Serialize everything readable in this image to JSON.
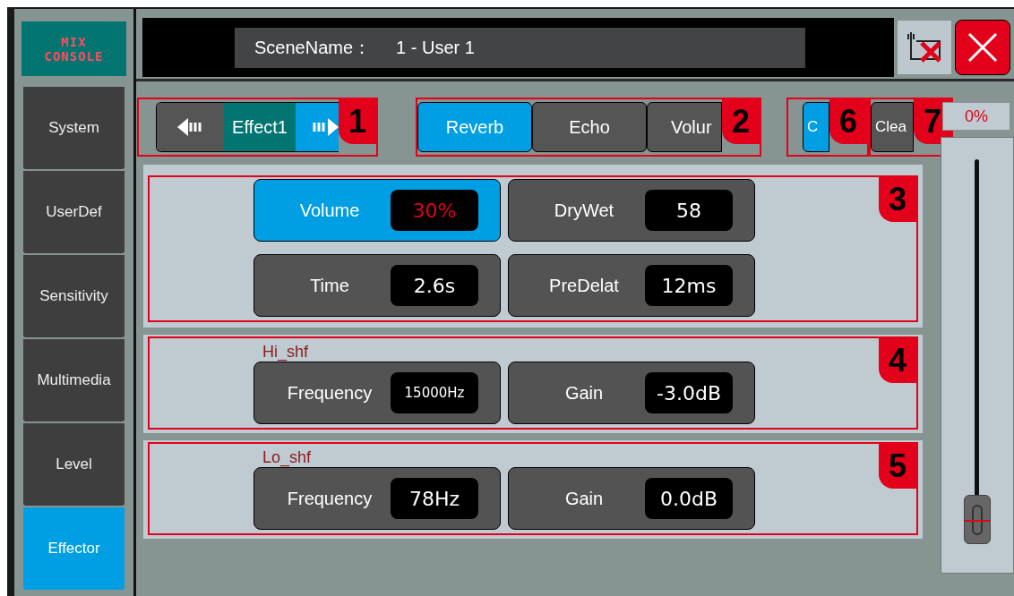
{
  "sidebar": {
    "logo_lines": [
      "MIX",
      "CONSOLE"
    ],
    "items": [
      {
        "label": "System",
        "selected": false
      },
      {
        "label": "UserDef",
        "selected": false
      },
      {
        "label": "Sensitivity",
        "selected": false
      },
      {
        "label": "Multimedia",
        "selected": false
      },
      {
        "label": "Level",
        "selected": false
      },
      {
        "label": "Effector",
        "selected": true
      }
    ]
  },
  "header": {
    "scene_label": "SceneName：",
    "scene_value": "1 - User 1"
  },
  "toolbar": {
    "effect_nav": {
      "label": "Effect1",
      "callout": "1"
    },
    "tabs": [
      {
        "label": "Reverb",
        "selected": true
      },
      {
        "label": "Echo",
        "selected": false
      },
      {
        "label": "Volur",
        "selected": false
      }
    ],
    "tabs_callout": "2",
    "actions": [
      {
        "label": "C",
        "selected": true,
        "callout": "6"
      },
      {
        "label": "Clea",
        "selected": false,
        "callout": "7"
      }
    ]
  },
  "sections": [
    {
      "callout": "3",
      "params": [
        {
          "label": "Volume",
          "value": "30%",
          "selected": true
        },
        {
          "label": "DryWet",
          "value": "58",
          "selected": false
        },
        {
          "label": "Time",
          "value": "2.6s",
          "selected": false
        },
        {
          "label": "PreDelat",
          "value": "12ms",
          "selected": false
        }
      ]
    },
    {
      "title": "Hi_shf",
      "callout": "4",
      "params": [
        {
          "label": "Frequency",
          "value": "15000Hz",
          "selected": false
        },
        {
          "label": "Gain",
          "value": "-3.0dB",
          "selected": false
        }
      ]
    },
    {
      "title": "Lo_shf",
      "callout": "5",
      "params": [
        {
          "label": "Frequency",
          "value": "78Hz",
          "selected": false
        },
        {
          "label": "Gain",
          "value": "0.0dB",
          "selected": false
        }
      ]
    }
  ],
  "fader": {
    "reading": "0%",
    "level": 0
  }
}
